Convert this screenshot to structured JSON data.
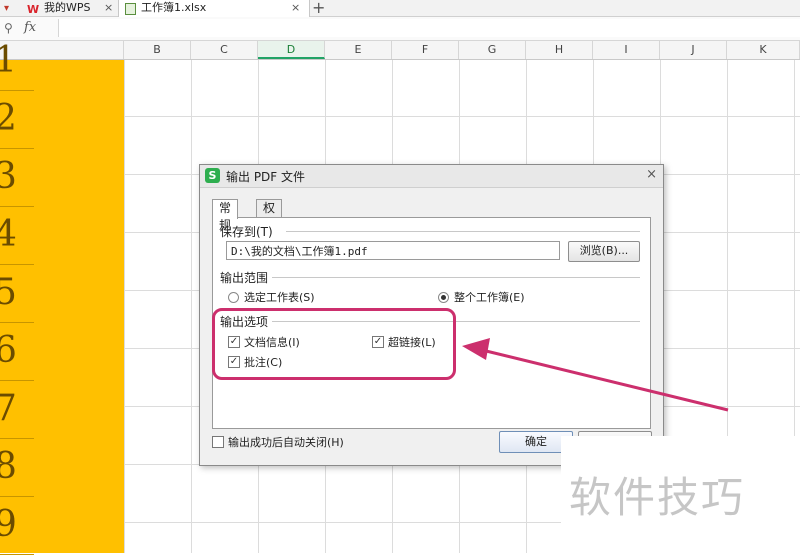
{
  "tabs": [
    {
      "label": "我的WPS",
      "close": "×"
    },
    {
      "label": "工作簿1.xlsx",
      "close": "×"
    }
  ],
  "new_tab": "+",
  "formula_bar": {
    "fx": "fx",
    "value": ""
  },
  "columns": [
    "B",
    "C",
    "D",
    "E",
    "F",
    "G",
    "H",
    "I",
    "J",
    "K"
  ],
  "active_column": "D",
  "row_numbers": [
    "1",
    "2",
    "3",
    "4",
    "5",
    "6",
    "7",
    "8",
    "9"
  ],
  "dialog": {
    "title": "输出 PDF 文件",
    "icon_glyph": "S",
    "close": "×",
    "tabs": [
      "常规",
      "权限设置"
    ],
    "save_to_label": "保存到(T)",
    "path_value": "D:\\我的文档\\工作簿1.pdf",
    "browse_label": "浏览(B)...",
    "range_label": "输出范围",
    "range_options": [
      {
        "label": "选定工作表(S)",
        "selected": false
      },
      {
        "label": "整个工作簿(E)",
        "selected": true
      }
    ],
    "options_label": "输出选项",
    "options": [
      {
        "label": "文档信息(I)",
        "checked": true
      },
      {
        "label": "超链接(L)",
        "checked": true
      },
      {
        "label": "批注(C)",
        "checked": true
      }
    ],
    "auto_close_label": "输出成功后自动关闭(H)",
    "auto_close_checked": false,
    "ok_label": "确定"
  },
  "watermark": "软件技巧",
  "colors": {
    "row_header": "#ffc000",
    "highlight": "#cc2f6d",
    "accent_green": "#21a366"
  }
}
